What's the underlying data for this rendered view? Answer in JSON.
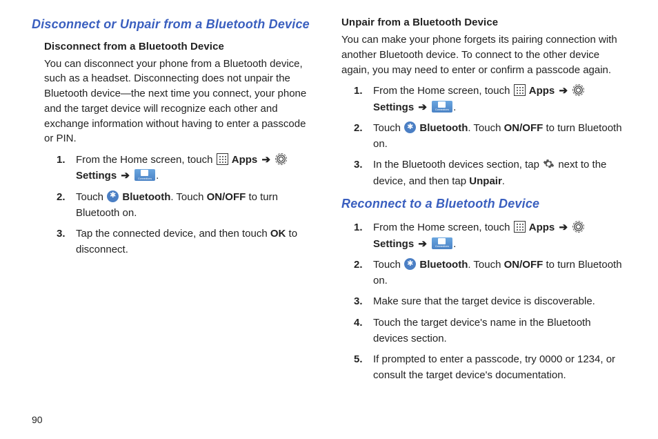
{
  "page_number": "90",
  "left": {
    "section_title": "Disconnect or Unpair from a Bluetooth Device",
    "sub_heading": "Disconnect from a Bluetooth Device",
    "intro": "You can disconnect your phone from a Bluetooth device, such as a headset. Disconnecting does not unpair the Bluetooth device—the next time you connect, your phone and the target device will recognize each other and exchange information without having to enter a passcode or PIN.",
    "steps": {
      "s1_a": "From the Home screen, touch ",
      "s1_apps": "Apps",
      "s1_settings": "Settings",
      "s2_a": "Touch ",
      "s2_bt": "Bluetooth",
      "s2_b": ". Touch ",
      "s2_onoff": "ON/OFF",
      "s2_c": " to turn Bluetooth on.",
      "s3_a": "Tap the connected device, and then touch ",
      "s3_ok": "OK",
      "s3_b": " to disconnect."
    }
  },
  "right": {
    "sub_heading": "Unpair from a Bluetooth Device",
    "intro": "You can make your phone forgets its pairing connection with another Bluetooth device. To connect to the other device again, you may need to enter or confirm a passcode again.",
    "steps": {
      "s1_a": "From the Home screen, touch ",
      "s1_apps": "Apps",
      "s1_settings": "Settings",
      "s2_a": "Touch ",
      "s2_bt": "Bluetooth",
      "s2_b": ". Touch ",
      "s2_onoff": "ON/OFF",
      "s2_c": " to turn Bluetooth on.",
      "s3_a": "In the Bluetooth devices section, tap ",
      "s3_b": " next to the device, and then tap ",
      "s3_unpair": "Unpair",
      "s3_c": "."
    },
    "reconnect_title": "Reconnect to a Bluetooth Device",
    "reconnect_steps": {
      "s1_a": "From the Home screen, touch ",
      "s1_apps": "Apps",
      "s1_settings": "Settings",
      "s2_a": "Touch ",
      "s2_bt": "Bluetooth",
      "s2_b": ". Touch ",
      "s2_onoff": "ON/OFF",
      "s2_c": " to turn Bluetooth on.",
      "s3": "Make sure that the target device is discoverable.",
      "s4": "Touch the target device's name in the Bluetooth devices section.",
      "s5": "If prompted to enter a passcode, try 0000 or 1234, or consult the target device's documentation."
    }
  },
  "arrow": "➔"
}
